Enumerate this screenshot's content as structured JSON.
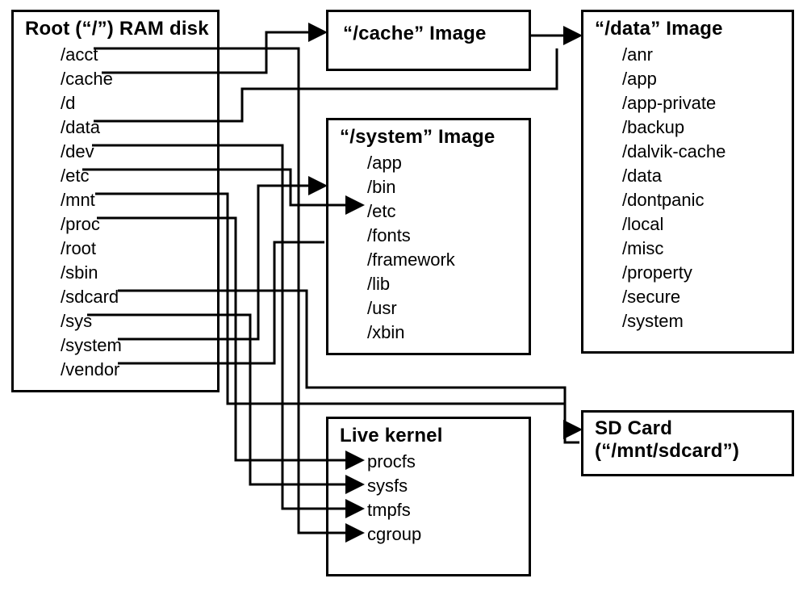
{
  "root": {
    "title": "Root (“/”) RAM disk",
    "items": [
      "/acct",
      "/cache",
      "/d",
      "/data",
      "/dev",
      "/etc",
      "/mnt",
      "/proc",
      "/root",
      "/sbin",
      "/sdcard",
      "/sys",
      "/system",
      "/vendor"
    ]
  },
  "cache": {
    "title": "“/cache” Image"
  },
  "data": {
    "title": "“/data” Image",
    "items": [
      "/anr",
      "/app",
      "/app-private",
      "/backup",
      "/dalvik-cache",
      "/data",
      "/dontpanic",
      "/local",
      "/misc",
      "/property",
      "/secure",
      "/system"
    ]
  },
  "system": {
    "title": "“/system” Image",
    "items": [
      "/app",
      "/bin",
      "/etc",
      "/fonts",
      "/framework",
      "/lib",
      "/usr",
      "/xbin"
    ]
  },
  "kernel": {
    "title": "Live kernel",
    "items": [
      "procfs",
      "sysfs",
      "tmpfs",
      "cgroup"
    ]
  },
  "sdcard": {
    "title_line1": "SD Card",
    "title_line2": "(“/mnt/sdcard”)"
  },
  "connections_note": "Arrows map root entries and images: /cache→cache image; /data(+cache image)→data image; /etc→/system/etc; /system→system image; /vendor(+system image)→; /sdcard→SD Card; /mnt links to SD Card path; /acct→cgroup; /proc→procfs; /sys→sysfs; /dev→tmpfs."
}
